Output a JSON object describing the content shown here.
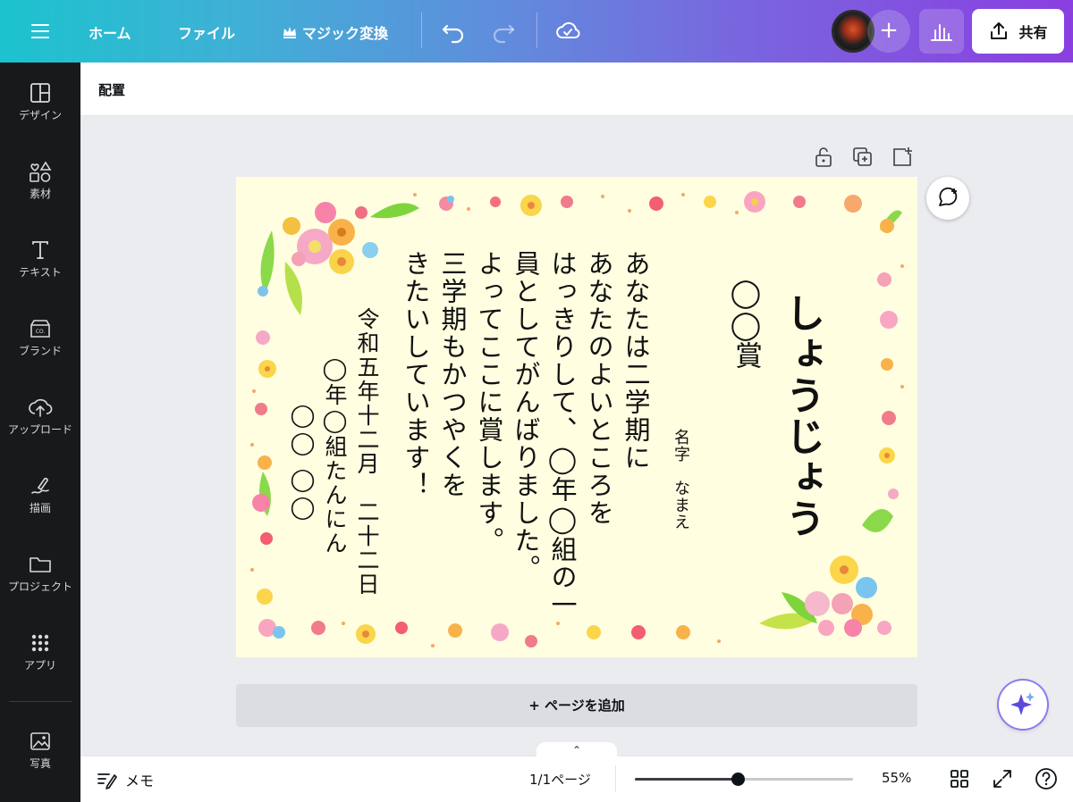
{
  "topbar": {
    "home": "ホーム",
    "file": "ファイル",
    "magic": "マジック変換",
    "share": "共有",
    "plus": "+"
  },
  "sidebar": {
    "items": [
      {
        "label": "デザイン",
        "icon": "layout-icon"
      },
      {
        "label": "素材",
        "icon": "elements-icon"
      },
      {
        "label": "テキスト",
        "icon": "text-icon"
      },
      {
        "label": "ブランド",
        "icon": "brand-icon"
      },
      {
        "label": "アップロード",
        "icon": "upload-icon"
      },
      {
        "label": "描画",
        "icon": "draw-icon"
      },
      {
        "label": "プロジェクト",
        "icon": "folder-icon"
      },
      {
        "label": "アプリ",
        "icon": "apps-icon"
      },
      {
        "label": "写真",
        "icon": "photo-icon"
      }
    ]
  },
  "subbar": {
    "label": "配置"
  },
  "certificate": {
    "title": "しょうじょう",
    "award": "◯◯賞",
    "name_field": "名字　なまえ",
    "body": "あなたは二学期に\nあなたのよいところを\nはっきりして、◯年◯組の一\n員としてがんばりました。\nよってここに賞します。\n三学期もかつやくを\nきたいしています！",
    "date": "令和五年十二月　二十二日",
    "class_line": "◯年◯組たんにん",
    "teacher": "◯◯ ◯◯"
  },
  "canvas": {
    "add_page": "+ ページを追加",
    "paper_color": "#fffee0"
  },
  "bottombar": {
    "memo": "メモ",
    "page_indicator": "1/1ページ",
    "zoom": "55%",
    "zoom_fraction": 0.47,
    "tab_glyph": "⌃"
  },
  "colors": {
    "sidebar_bg": "#18191b",
    "accent_gradient_start": "#1cc3ce",
    "accent_gradient_end": "#8a3fe0"
  }
}
